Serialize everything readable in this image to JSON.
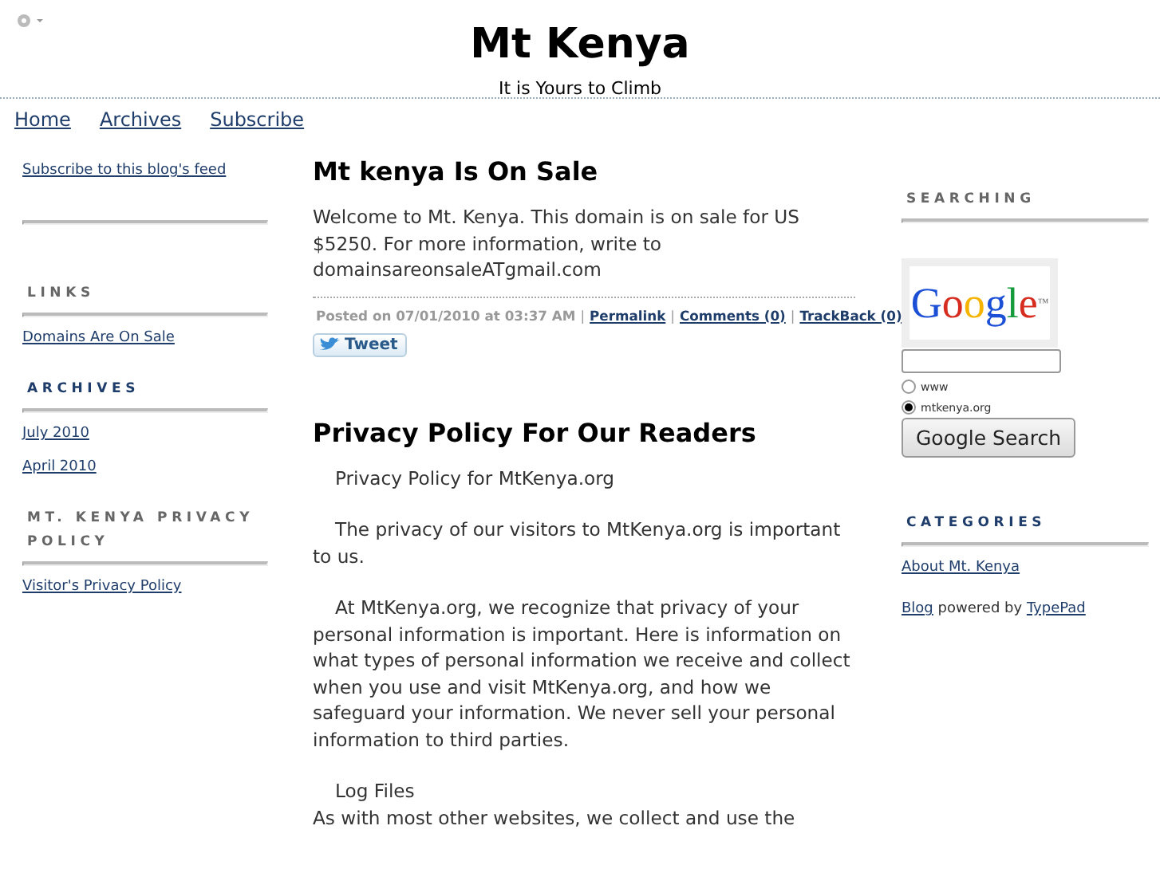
{
  "header": {
    "title": "Mt Kenya",
    "tagline": "It is Yours to Climb"
  },
  "nav": [
    "Home",
    "Archives",
    "Subscribe"
  ],
  "left": {
    "feed_link": "Subscribe to this blog's feed",
    "sections": [
      {
        "title": "LINKS",
        "color": "#666666",
        "items": [
          "Domains Are On Sale"
        ]
      },
      {
        "title": "ARCHIVES",
        "color": "#1f3d6b",
        "items": [
          "July 2010",
          "April 2010"
        ]
      },
      {
        "title": "MT. KENYA PRIVACY POLICY",
        "color": "#666666",
        "items": [
          "Visitor's Privacy Policy"
        ]
      }
    ]
  },
  "posts": [
    {
      "title": "Mt kenya Is On Sale",
      "indent": false,
      "paragraphs": [
        "Welcome to Mt. Kenya. This domain is on sale for US $5250. For more information, write to domainsareonsaleATgmail.com"
      ],
      "meta": [
        {
          "kind": "text",
          "text": "Posted on 07/01/2010 at 03:37 AM"
        },
        {
          "kind": "sep",
          "text": "|"
        },
        {
          "kind": "link",
          "text": "Permalink"
        },
        {
          "kind": "sep",
          "text": "|"
        },
        {
          "kind": "link",
          "text": "Comments (0)"
        },
        {
          "kind": "sep",
          "text": "|"
        },
        {
          "kind": "link",
          "text": "TrackBack (0)"
        }
      ],
      "tweet": "Tweet"
    },
    {
      "title": "Privacy Policy For Our Readers",
      "indent": true,
      "paragraphs": [
        "Privacy Policy for MtKenya.org",
        "The privacy of our visitors to MtKenya.org is important to us.",
        "At MtKenya.org, we recognize that privacy of your personal information is important. Here is information on what types of personal information we receive and collect when you use and visit MtKenya.org, and how we safeguard your information.  We never sell your personal information to third parties.",
        "Log Files\nAs with most other websites, we collect and use the"
      ]
    }
  ],
  "right": {
    "search": {
      "title": "SEARCHING",
      "color": "#666666",
      "logo": "Google",
      "logo_mark": "™",
      "options": [
        {
          "label": "www",
          "selected": false
        },
        {
          "label": "mtkenya.org",
          "selected": true
        }
      ],
      "button": "Google Search"
    },
    "categories": {
      "title": "CATEGORIES",
      "color": "#1f3d6b",
      "items": [
        "About Mt. Kenya"
      ]
    },
    "powered": [
      {
        "kind": "link",
        "text": "Blog"
      },
      {
        "kind": "text",
        "text": "powered by"
      },
      {
        "kind": "link",
        "text": "TypePad"
      }
    ]
  }
}
